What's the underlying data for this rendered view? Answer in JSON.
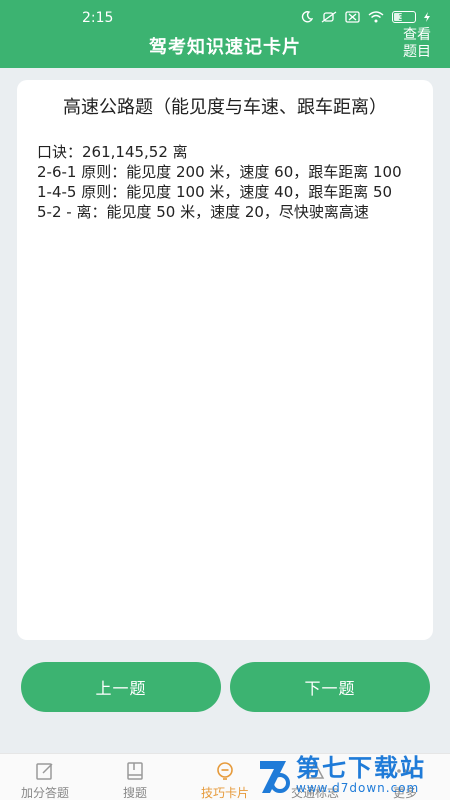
{
  "status": {
    "time": "2:15",
    "battery": "36"
  },
  "header": {
    "title": "驾考知识速记卡片",
    "view_label_line1": "查看",
    "view_label_line2": "题目"
  },
  "card": {
    "title": "高速公路题（能见度与车速、跟车距离）",
    "lines": [
      "口诀：261,145,52 离",
      "2-6-1 原则：能见度 200 米，速度 60，跟车距离 100",
      "1-4-5 原则：能见度 100 米，速度 40，跟车距离 50",
      "5-2 - 离：能见度 50 米，速度 20，尽快驶离高速"
    ]
  },
  "buttons": {
    "prev": "上一题",
    "next": "下一题"
  },
  "bottom_nav": [
    {
      "label": "加分答题",
      "icon": "edit-icon",
      "active": false
    },
    {
      "label": "搜题",
      "icon": "book-icon",
      "active": false
    },
    {
      "label": "技巧卡片",
      "icon": "tips-icon",
      "active": true
    },
    {
      "label": "交通标志",
      "icon": "sign-icon",
      "active": false
    },
    {
      "label": "更多",
      "icon": "more-icon",
      "active": false
    }
  ],
  "watermark": {
    "main": "第七下载站",
    "sub": "www.d7down.com"
  },
  "colors": {
    "primary": "#3cb371",
    "active_tab": "#e69a3a",
    "background": "#eaeef1"
  }
}
